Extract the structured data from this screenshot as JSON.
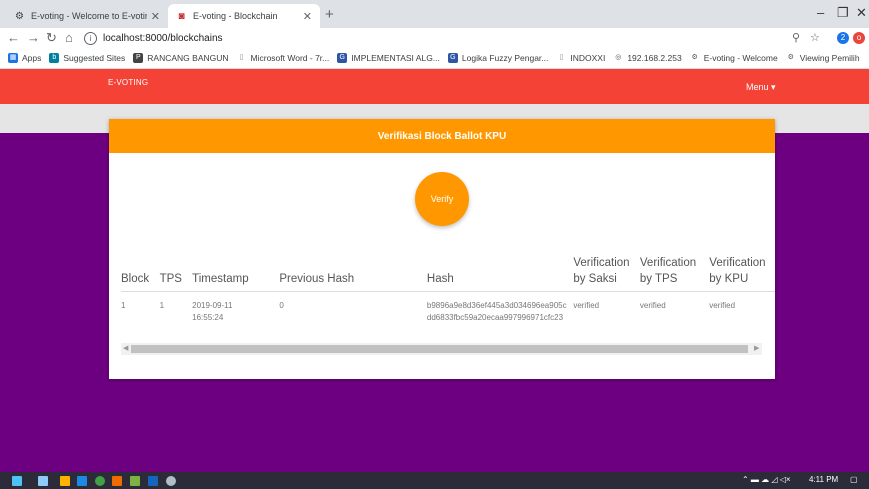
{
  "browser": {
    "tabs": [
      {
        "title": "E-voting - Welcome to E-voting",
        "active": false
      },
      {
        "title": "E-voting - Blockchain",
        "active": true
      }
    ],
    "url": "localhost:8000/blockchains",
    "bookmarks": [
      {
        "label": "Apps",
        "icon": "apps-grid-icon",
        "color": "#1a73e8"
      },
      {
        "label": "Suggested Sites",
        "icon": "bing-icon",
        "color": "#00809d"
      },
      {
        "label": "RANCANG BANGUN",
        "icon": "pnp-icon",
        "color": "#444444"
      },
      {
        "label": "Microsoft Word - 7r...",
        "icon": "page-icon",
        "color": "#888888"
      },
      {
        "label": "IMPLEMENTASI ALG...",
        "icon": "scholar-icon",
        "color": "#2f56a5"
      },
      {
        "label": "Logika Fuzzy Pengar...",
        "icon": "scholar-icon",
        "color": "#2f56a5"
      },
      {
        "label": "INDOXXI",
        "icon": "page-icon",
        "color": "#888888"
      },
      {
        "label": "192.168.2.253",
        "icon": "globe-icon",
        "color": "#555555"
      },
      {
        "label": "E-voting - Welcome",
        "icon": "gear-icon",
        "color": "#555555"
      },
      {
        "label": "Viewing Pemilih",
        "icon": "gear-icon",
        "color": "#555555"
      }
    ]
  },
  "navbar": {
    "brand": "E-VOTING",
    "menu": "Menu ▾"
  },
  "card": {
    "title": "Verifikasi Block Ballot KPU",
    "verify_label": "Verify"
  },
  "table": {
    "headers": [
      "Block",
      "TPS",
      "Timestamp",
      "Previous Hash",
      "Hash",
      "Verification by Saksi",
      "Verification by TPS",
      "Verification by KPU"
    ],
    "rows": [
      {
        "block": "1",
        "tps": "1",
        "timestamp": "2019-09-11 16:55:24",
        "previous_hash": "0",
        "hash": "b9896a9e8d36ef445a3d034696ea905cdd6833fbc59a20ecaa997996971cfc23",
        "by_saksi": "verified",
        "by_tps": "verified",
        "by_kpu": "verified"
      }
    ]
  },
  "taskbar": {
    "time": "4:11 PM"
  },
  "colors": {
    "navbar": "#f44336",
    "accent": "#ff9800",
    "page_bg": "#6d0080"
  }
}
